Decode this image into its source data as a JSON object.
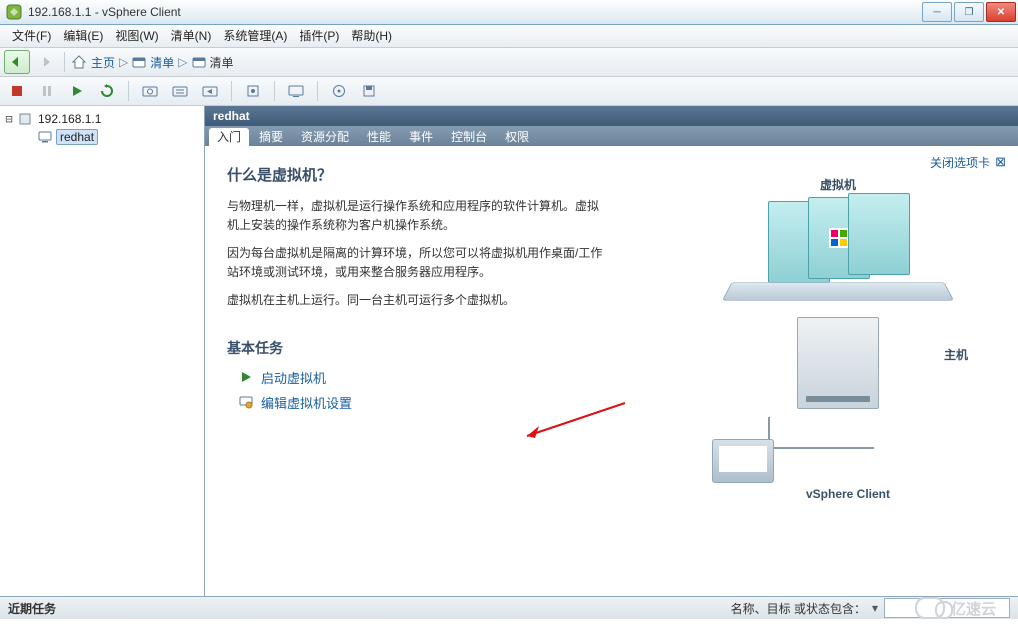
{
  "window": {
    "title": "192.168.1.1 - vSphere Client"
  },
  "menu": [
    "文件(F)",
    "编辑(E)",
    "视图(W)",
    "清单(N)",
    "系统管理(A)",
    "插件(P)",
    "帮助(H)"
  ],
  "nav": {
    "home": "主页",
    "crumb1_icon": "inventory-icon",
    "crumb1": "清单",
    "crumb2_icon": "inventory-icon",
    "crumb2": "清单"
  },
  "tree": {
    "root": "192.168.1.1",
    "child": "redhat"
  },
  "object_header": "redhat",
  "tabs": [
    "入门",
    "摘要",
    "资源分配",
    "性能",
    "事件",
    "控制台",
    "权限"
  ],
  "content": {
    "close_tab": "关闭选项卡",
    "heading": "什么是虚拟机？",
    "p1": "与物理机一样，虚拟机是运行操作系统和应用程序的软件计算机。虚拟机上安装的操作系统称为客户机操作系统。",
    "p2": "因为每台虚拟机是隔离的计算环境，所以您可以将虚拟机用作桌面/工作站环境或测试环境，或用来整合服务器应用程序。",
    "p3": "虚拟机在主机上运行。同一台主机可运行多个虚拟机。",
    "tasks_head": "基本任务",
    "task_start": "启动虚拟机",
    "task_edit": "编辑虚拟机设置",
    "illus_vm": "虚拟机",
    "illus_host": "主机",
    "illus_client": "vSphere Client"
  },
  "status": {
    "left": "近期任务",
    "filter_label": "名称、目标 或状态包含：",
    "filter_value": ""
  },
  "watermark": "亿速云"
}
